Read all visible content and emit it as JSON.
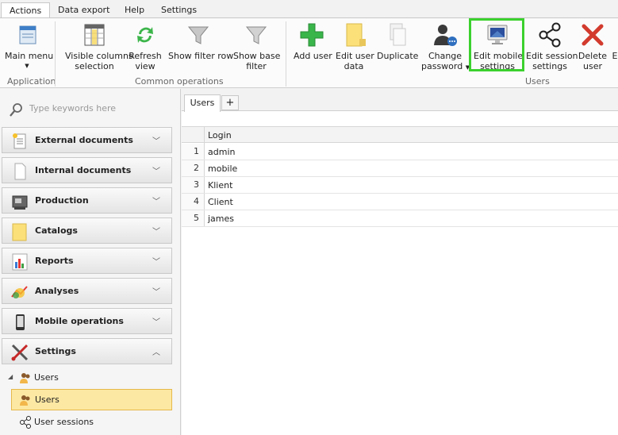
{
  "menu": {
    "tabs": [
      {
        "label": "Actions"
      },
      {
        "label": "Data export"
      },
      {
        "label": "Help"
      },
      {
        "label": "Settings"
      }
    ]
  },
  "ribbon": {
    "buttons": {
      "main_menu": "Main menu",
      "visible_columns": [
        "Visible columns",
        "selection"
      ],
      "refresh": [
        "Refresh",
        "view"
      ],
      "show_filter_row": "Show filter row",
      "show_base_filter": [
        "Show base",
        "filter"
      ],
      "add_user": "Add user",
      "edit_user_data": [
        "Edit user",
        "data"
      ],
      "duplicate": "Duplicate",
      "change_password": [
        "Change",
        "password"
      ],
      "edit_mobile": [
        "Edit mobile",
        "settings"
      ],
      "edit_session": [
        "Edit session",
        "settings"
      ],
      "delete_user": [
        "Delete",
        "user"
      ],
      "overflow": "E"
    },
    "groups": {
      "application": "Application",
      "common": "Common operations",
      "users": "Users"
    }
  },
  "sidebar": {
    "search_placeholder": "Type keywords here",
    "items": [
      {
        "label": "External documents",
        "icon": "document-star-icon"
      },
      {
        "label": "Internal documents",
        "icon": "document-icon"
      },
      {
        "label": "Production",
        "icon": "machine-icon"
      },
      {
        "label": "Catalogs",
        "icon": "catalog-icon"
      },
      {
        "label": "Reports",
        "icon": "chart-icon"
      },
      {
        "label": "Analyses",
        "icon": "analyses-icon"
      },
      {
        "label": "Mobile operations",
        "icon": "mobile-icon"
      },
      {
        "label": "Settings",
        "icon": "tools-icon"
      }
    ],
    "tree": {
      "parent": "Users",
      "selected": "Users",
      "child": "User sessions"
    }
  },
  "main": {
    "tab": "Users",
    "add_tab": "+",
    "column": "Login",
    "rows": [
      {
        "n": "1",
        "login": "admin"
      },
      {
        "n": "2",
        "login": "mobile"
      },
      {
        "n": "3",
        "login": "Klient"
      },
      {
        "n": "4",
        "login": "Client"
      },
      {
        "n": "5",
        "login": "james"
      }
    ]
  },
  "colors": {
    "highlight": "#3bd12e",
    "selected_bg": "#fde8a3"
  }
}
